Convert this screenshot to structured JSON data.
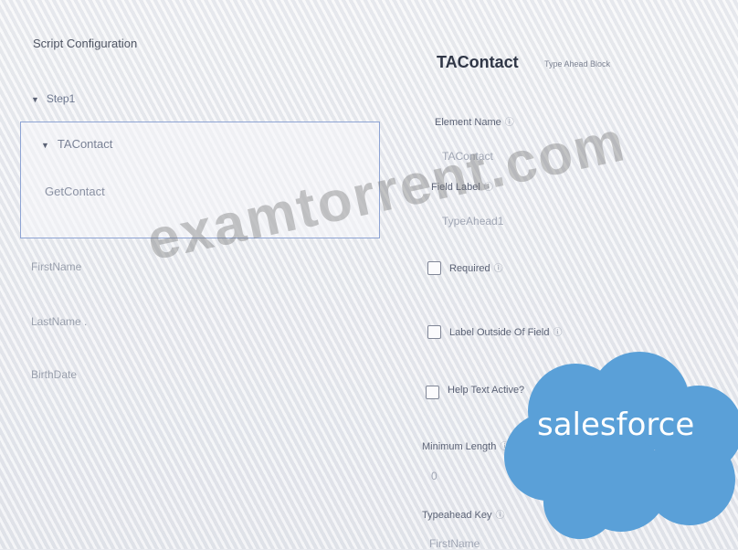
{
  "left_panel": {
    "title": "Script Configuration",
    "step": "Step1",
    "group": "TAContact",
    "group_child": "GetContact",
    "fields": [
      "FirstName",
      "LastName .",
      "BirthDate"
    ]
  },
  "right_panel": {
    "element_title": "TAContact",
    "element_type": "Type Ahead Block",
    "info_glyph": "ⓘ",
    "element_name_label": "Element Name",
    "element_name_value": "TAContact",
    "field_label_label": "Field Label",
    "field_label_value": "TypeAhead1",
    "required_label": "Required",
    "label_outside_label": "Label Outside Of Field",
    "help_text_label": "Help Text Active?",
    "min_length_label": "Minimum Length",
    "min_length_value": "0",
    "typeahead_key_label": "Typeahead Key",
    "typeahead_key_value": "FirstName"
  },
  "overlays": {
    "watermark": "examtorrent.com",
    "logo_text": "salesforce",
    "logo_color": "#5aa0d8"
  }
}
